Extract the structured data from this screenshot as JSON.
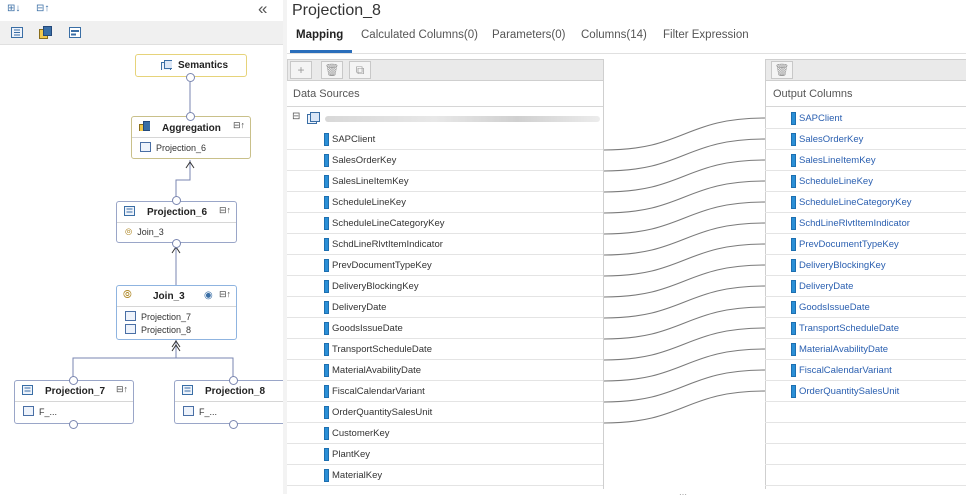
{
  "left_panel": {
    "collapse_label": "«",
    "nodes": {
      "semantics": {
        "title": "Semantics"
      },
      "aggregation": {
        "title": "Aggregation",
        "rows": [
          "Projection_6"
        ]
      },
      "projection6": {
        "title": "Projection_6",
        "rows": [
          "Join_3"
        ]
      },
      "join3": {
        "title": "Join_3",
        "rows": [
          "Projection_7",
          "Projection_8"
        ]
      },
      "projection7": {
        "title": "Projection_7",
        "rows": [
          "F_..."
        ]
      },
      "projection8": {
        "title": "Projection_8",
        "rows": [
          "F_..."
        ]
      }
    }
  },
  "right_panel": {
    "title": "Projection_8",
    "tabs": [
      "Mapping",
      "Calculated Columns(0)",
      "Parameters(0)",
      "Columns(14)",
      "Filter Expression"
    ],
    "active_tab": "Mapping",
    "data_sources": {
      "header": "Data Sources",
      "columns": [
        "SAPClient",
        "SalesOrderKey",
        "SalesLineItemKey",
        "ScheduleLineKey",
        "ScheduleLineCategoryKey",
        "SchdLineRlvtItemIndicator",
        "PrevDocumentTypeKey",
        "DeliveryBlockingKey",
        "DeliveryDate",
        "GoodsIssueDate",
        "TransportScheduleDate",
        "MaterialAvabilityDate",
        "FiscalCalendarVariant",
        "OrderQuantitySalesUnit",
        "CustomerKey",
        "PlantKey",
        "MaterialKey"
      ]
    },
    "output_columns": {
      "header": "Output Columns",
      "columns": [
        "SAPClient",
        "SalesOrderKey",
        "SalesLineItemKey",
        "ScheduleLineKey",
        "ScheduleLineCategoryKey",
        "SchdLineRlvtItemIndicator",
        "PrevDocumentTypeKey",
        "DeliveryBlockingKey",
        "DeliveryDate",
        "GoodsIssueDate",
        "TransportScheduleDate",
        "MaterialAvabilityDate",
        "FiscalCalendarVariant",
        "OrderQuantitySalesUnit"
      ]
    }
  }
}
